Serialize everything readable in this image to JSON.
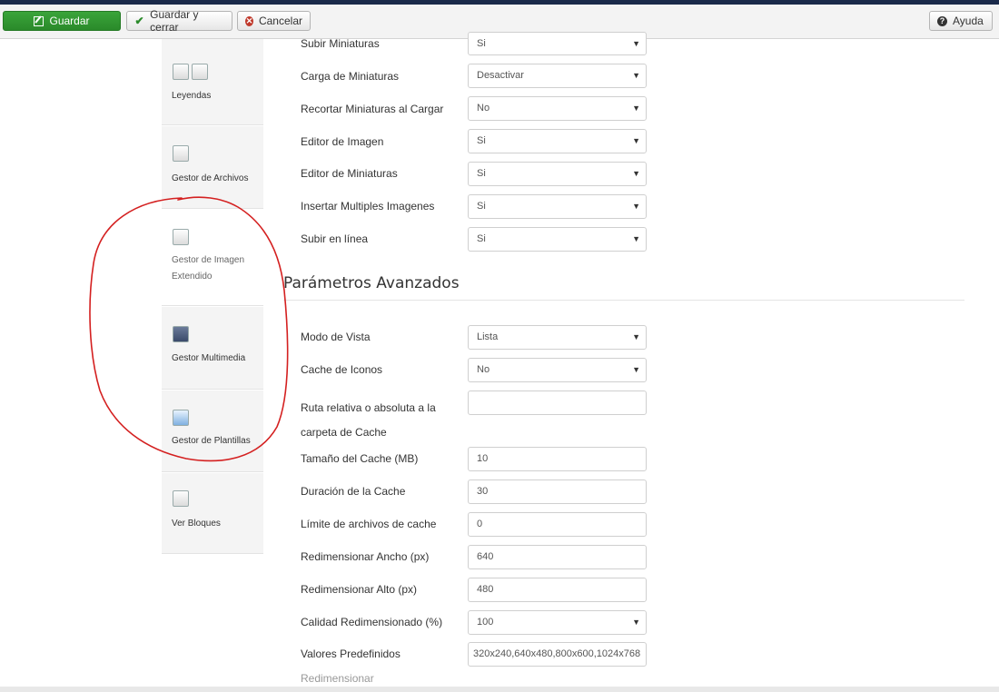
{
  "toolbar": {
    "save": "Guardar",
    "save_close": "Guardar y cerrar",
    "cancel": "Cancelar",
    "help": "Ayuda"
  },
  "sidebar": {
    "items": [
      {
        "label": "Leyendas",
        "icon": "captions-icon"
      },
      {
        "label": "Gestor de Archivos",
        "icon": "file-manager-icon"
      },
      {
        "label": "Gestor de Imagen Extendido",
        "icon": "image-manager-icon"
      },
      {
        "label": "Gestor Multimedia",
        "icon": "media-manager-icon"
      },
      {
        "label": "Gestor de Plantillas",
        "icon": "template-manager-icon"
      },
      {
        "label": "Ver Bloques",
        "icon": "show-blocks-icon"
      }
    ]
  },
  "form": {
    "upload_rows": [
      {
        "label": "Subir Miniaturas",
        "value": "Si",
        "type": "select"
      },
      {
        "label": "Carga de Miniaturas",
        "value": "Desactivar",
        "type": "select"
      },
      {
        "label": "Recortar Miniaturas al Cargar",
        "value": "No",
        "type": "select"
      },
      {
        "label": "Editor de Imagen",
        "value": "Si",
        "type": "select"
      },
      {
        "label": "Editor de Miniaturas",
        "value": "Si",
        "type": "select"
      },
      {
        "label": "Insertar Multiples Imagenes",
        "value": "Si",
        "type": "select"
      },
      {
        "label": "Subir en línea",
        "value": "Si",
        "type": "select"
      }
    ],
    "advanced_title": "Parámetros Avanzados",
    "advanced_rows": [
      {
        "label": "Modo de Vista",
        "value": "Lista",
        "type": "select"
      },
      {
        "label": "Cache de Iconos",
        "value": "No",
        "type": "select"
      },
      {
        "label": "Ruta relativa o absoluta a la carpeta de Cache",
        "value": "",
        "type": "input"
      },
      {
        "label": "Tamaño del Cache (MB)",
        "value": "10",
        "type": "input"
      },
      {
        "label": "Duración de la Cache",
        "value": "30",
        "type": "input"
      },
      {
        "label": "Límite de archivos de cache",
        "value": "0",
        "type": "input"
      },
      {
        "label": "Redimensionar Ancho (px)",
        "value": "640",
        "type": "input"
      },
      {
        "label": "Redimensionar Alto (px)",
        "value": "480",
        "type": "input"
      },
      {
        "label": "Calidad Redimensionado (%)",
        "value": "100",
        "type": "select"
      },
      {
        "label": "Valores Predefinidos",
        "value": "320x240,640x480,800x600,1024x768",
        "type": "input"
      }
    ],
    "cutoff_label": "Redimensionar"
  },
  "colors": {
    "save_green": "#2a8a2a",
    "annotation_red": "#d42020",
    "topbar": "#1a2a4a"
  }
}
